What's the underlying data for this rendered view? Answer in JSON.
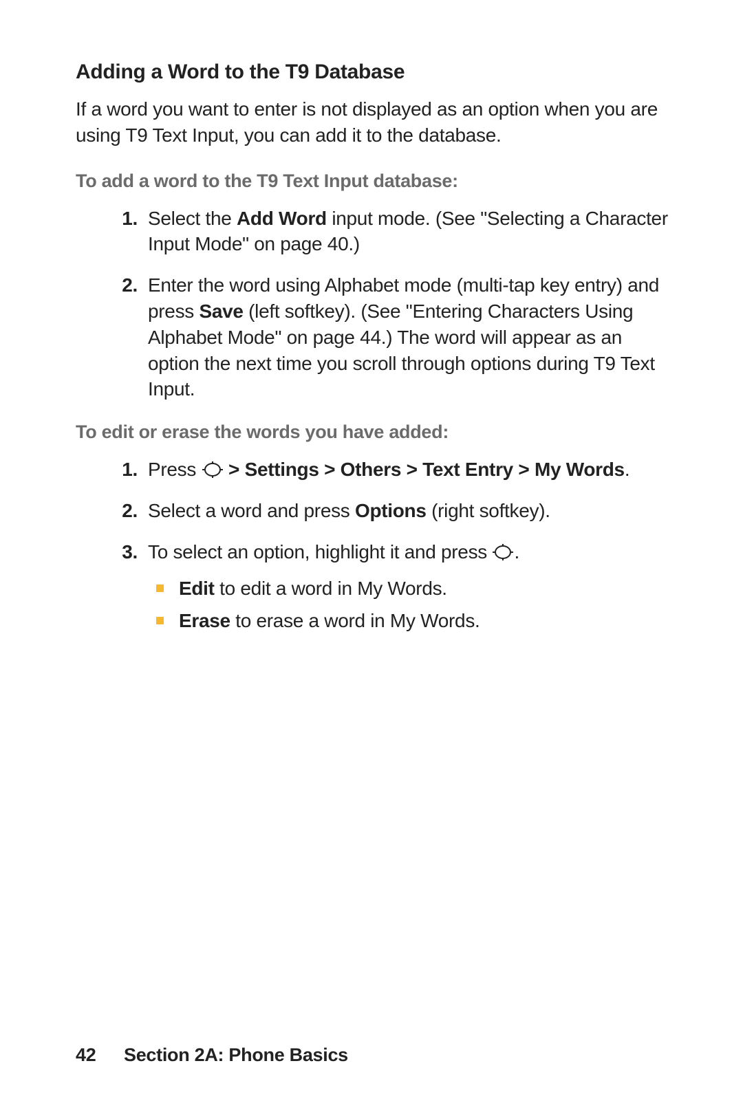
{
  "title": "Adding a Word to the T9 Database",
  "intro": "If a word you want to enter is not displayed as an option when you are using T9 Text Input, you can add it to the database.",
  "subhead1": "To add a word to the T9 Text Input database:",
  "add_steps": {
    "s1_num": "1.",
    "s1_a": "Select the ",
    "s1_bold": "Add Word",
    "s1_b": " input mode. (See \"Selecting a Character Input Mode\" on page 40.)",
    "s2_num": "2.",
    "s2_a": "Enter the word using Alphabet mode (multi-tap key entry) and press ",
    "s2_bold": "Save",
    "s2_b": " (left softkey). (See \"Entering Characters Using Alphabet Mode\" on page 44.) The word will appear as an option the next time you scroll through options during T9 Text Input."
  },
  "subhead2": "To edit or erase the words you have added:",
  "edit_steps": {
    "s1_num": "1.",
    "s1_a": "Press ",
    "s1_bold": " > Settings > Others > Text Entry > My Words",
    "s1_b": ".",
    "s2_num": "2.",
    "s2_a": "Select a word and press ",
    "s2_bold": "Options",
    "s2_b": " (right softkey).",
    "s3_num": "3.",
    "s3_a": "To select an option, highlight it and press ",
    "s3_b": "."
  },
  "sub_items": {
    "edit_bold": "Edit",
    "edit_rest": " to edit a word in My Words.",
    "erase_bold": "Erase",
    "erase_rest": " to erase a word in My Words."
  },
  "footer": {
    "page_number": "42",
    "section": "Section 2A: Phone Basics"
  }
}
